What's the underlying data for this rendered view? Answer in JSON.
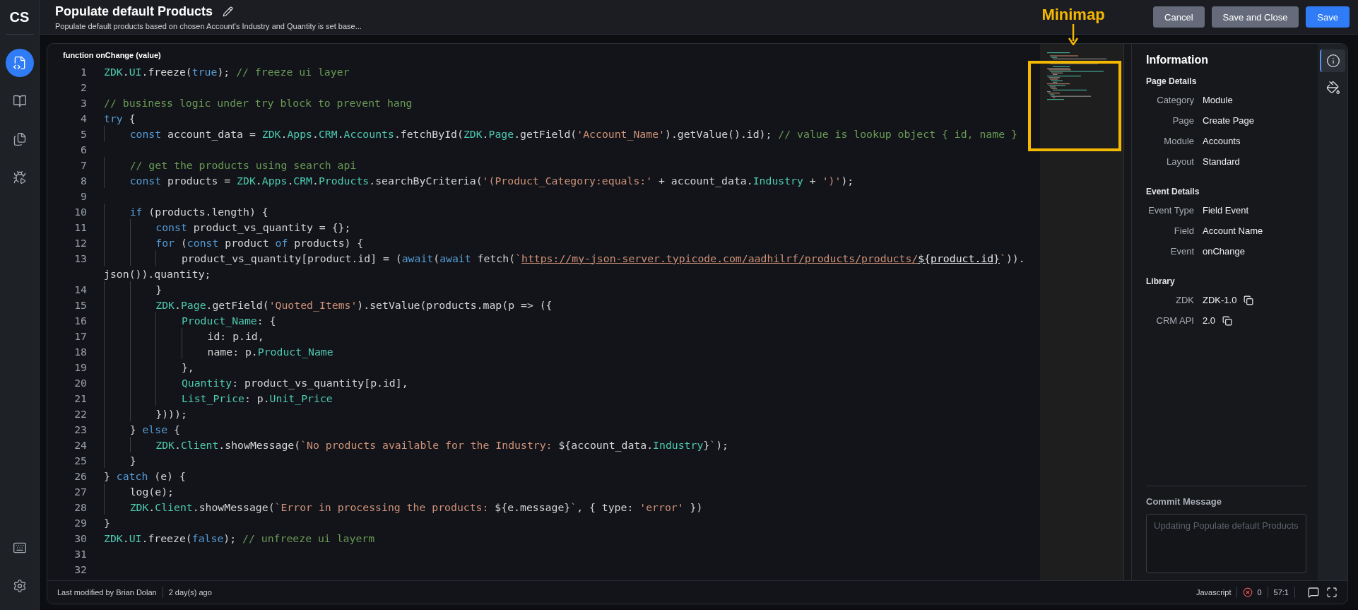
{
  "sidebar": {
    "logo": "CS",
    "items": [
      {
        "kind": "code",
        "selected": true
      },
      {
        "kind": "book",
        "selected": false
      },
      {
        "kind": "docs",
        "selected": false
      },
      {
        "kind": "run",
        "selected": false
      }
    ]
  },
  "header": {
    "title": "Populate default Products",
    "subtitle": "Populate default products based on chosen Account's Industry and Quantity is set base...",
    "buttons": [
      {
        "label": "Cancel",
        "kind": "secondary"
      },
      {
        "label": "Save and Close",
        "kind": "secondary"
      },
      {
        "label": "Save",
        "kind": "primary"
      }
    ]
  },
  "annotation": {
    "label": "Minimap"
  },
  "editor": {
    "signature": "function onChange (value)",
    "lines": [
      {
        "number": "1",
        "tokens": [
          {
            "kind": "obj",
            "text": "ZDK"
          },
          {
            "kind": "txt",
            "text": "."
          },
          {
            "kind": "obj",
            "text": "UI"
          },
          {
            "kind": "txt",
            "text": ".freeze("
          },
          {
            "kind": "kw",
            "text": "true"
          },
          {
            "kind": "txt",
            "text": "); "
          },
          {
            "kind": "cm",
            "text": "// freeze ui layer"
          }
        ]
      },
      {
        "number": "2"
      },
      {
        "number": "3",
        "tokens": [
          {
            "kind": "cm",
            "text": "// business logic under try block to prevent hang"
          }
        ]
      },
      {
        "number": "4",
        "tokens": [
          {
            "kind": "kw",
            "text": "try"
          },
          {
            "kind": "txt",
            "text": " {"
          }
        ]
      },
      {
        "number": "5",
        "tokens": [
          {
            "kind": "kw",
            "text": "    const"
          },
          {
            "kind": "txt",
            "text": " account_data = "
          },
          {
            "kind": "obj",
            "text": "ZDK"
          },
          {
            "kind": "txt",
            "text": "."
          },
          {
            "kind": "obj",
            "text": "Apps"
          },
          {
            "kind": "txt",
            "text": "."
          },
          {
            "kind": "obj",
            "text": "CRM"
          },
          {
            "kind": "txt",
            "text": "."
          },
          {
            "kind": "obj",
            "text": "Accounts"
          },
          {
            "kind": "txt",
            "text": ".fetchById("
          },
          {
            "kind": "obj",
            "text": "ZDK"
          },
          {
            "kind": "txt",
            "text": "."
          },
          {
            "kind": "obj",
            "text": "Page"
          },
          {
            "kind": "txt",
            "text": ".getField("
          },
          {
            "kind": "str",
            "text": "'Account_Name'"
          },
          {
            "kind": "txt",
            "text": ").getValue().id); "
          },
          {
            "kind": "cm",
            "text": "// value is lookup object { id, name }"
          }
        ]
      },
      {
        "number": "6"
      },
      {
        "number": "7",
        "tokens": [
          {
            "kind": "cm",
            "text": "    // get the products using search api"
          }
        ]
      },
      {
        "number": "8",
        "tokens": [
          {
            "kind": "kw",
            "text": "    const"
          },
          {
            "kind": "txt",
            "text": " products = "
          },
          {
            "kind": "obj",
            "text": "ZDK"
          },
          {
            "kind": "txt",
            "text": "."
          },
          {
            "kind": "obj",
            "text": "Apps"
          },
          {
            "kind": "txt",
            "text": "."
          },
          {
            "kind": "obj",
            "text": "CRM"
          },
          {
            "kind": "txt",
            "text": "."
          },
          {
            "kind": "obj",
            "text": "Products"
          },
          {
            "kind": "txt",
            "text": ".searchByCriteria("
          },
          {
            "kind": "str",
            "text": "'(Product_Category:equals:'"
          },
          {
            "kind": "txt",
            "text": " + account_data."
          },
          {
            "kind": "obj",
            "text": "Industry"
          },
          {
            "kind": "txt",
            "text": " + "
          },
          {
            "kind": "str",
            "text": "')'"
          },
          {
            "kind": "txt",
            "text": ");"
          }
        ]
      },
      {
        "number": "9"
      },
      {
        "number": "10",
        "tokens": [
          {
            "kind": "kw",
            "text": "    if"
          },
          {
            "kind": "txt",
            "text": " (products.length) {"
          }
        ]
      },
      {
        "number": "11",
        "tokens": [
          {
            "kind": "kw",
            "text": "        const"
          },
          {
            "kind": "txt",
            "text": " product_vs_quantity = {};"
          }
        ]
      },
      {
        "number": "12",
        "tokens": [
          {
            "kind": "kw",
            "text": "        for"
          },
          {
            "kind": "txt",
            "text": " ("
          },
          {
            "kind": "kw",
            "text": "const"
          },
          {
            "kind": "txt",
            "text": " product "
          },
          {
            "kind": "kw",
            "text": "of"
          },
          {
            "kind": "txt",
            "text": " products) {"
          }
        ]
      },
      {
        "number": "13",
        "tokens": [
          {
            "kind": "txt",
            "text": "            product_vs_quantity[product.id] = ("
          },
          {
            "kind": "kw",
            "text": "await"
          },
          {
            "kind": "txt",
            "text": "("
          },
          {
            "kind": "kw",
            "text": "await"
          },
          {
            "kind": "txt",
            "text": " fetch("
          },
          {
            "kind": "str",
            "text": "`"
          },
          {
            "kind": "url",
            "text": "https://my-json-server.typicode.com/aadhilrf/products/products/"
          },
          {
            "kind": "tpl",
            "text": "${product.id}"
          },
          {
            "kind": "str",
            "text": "`"
          },
          {
            "kind": "txt",
            "text": "))."
          }
        ],
        "continuation": [
          {
            "kind": "txt",
            "text": "json()).quantity;"
          }
        ]
      },
      {
        "number": "14",
        "tokens": [
          {
            "kind": "txt",
            "text": "        }"
          }
        ]
      },
      {
        "number": "15",
        "tokens": [
          {
            "kind": "obj",
            "text": "        ZDK"
          },
          {
            "kind": "txt",
            "text": "."
          },
          {
            "kind": "obj",
            "text": "Page"
          },
          {
            "kind": "txt",
            "text": ".getField("
          },
          {
            "kind": "str",
            "text": "'Quoted_Items'"
          },
          {
            "kind": "txt",
            "text": ").setValue(products.map(p => ({"
          }
        ]
      },
      {
        "number": "16",
        "tokens": [
          {
            "kind": "obj",
            "text": "            Product_Name"
          },
          {
            "kind": "txt",
            "text": ": {"
          }
        ]
      },
      {
        "number": "17",
        "tokens": [
          {
            "kind": "txt",
            "text": "                id: p.id,"
          }
        ]
      },
      {
        "number": "18",
        "tokens": [
          {
            "kind": "txt",
            "text": "                name: p."
          },
          {
            "kind": "obj",
            "text": "Product_Name"
          }
        ]
      },
      {
        "number": "19",
        "tokens": [
          {
            "kind": "txt",
            "text": "            },"
          }
        ]
      },
      {
        "number": "20",
        "tokens": [
          {
            "kind": "obj",
            "text": "            Quantity"
          },
          {
            "kind": "txt",
            "text": ": product_vs_quantity[p.id],"
          }
        ]
      },
      {
        "number": "21",
        "tokens": [
          {
            "kind": "obj",
            "text": "            List_Price"
          },
          {
            "kind": "txt",
            "text": ": p."
          },
          {
            "kind": "obj",
            "text": "Unit_Price"
          }
        ]
      },
      {
        "number": "22",
        "tokens": [
          {
            "kind": "txt",
            "text": "        })));"
          }
        ]
      },
      {
        "number": "23",
        "tokens": [
          {
            "kind": "txt",
            "text": "    } "
          },
          {
            "kind": "kw",
            "text": "else"
          },
          {
            "kind": "txt",
            "text": " {"
          }
        ]
      },
      {
        "number": "24",
        "tokens": [
          {
            "kind": "obj",
            "text": "        ZDK"
          },
          {
            "kind": "txt",
            "text": "."
          },
          {
            "kind": "obj",
            "text": "Client"
          },
          {
            "kind": "txt",
            "text": ".showMessage("
          },
          {
            "kind": "str",
            "text": "`No products available for the Industry: "
          },
          {
            "kind": "txt",
            "text": "${account_data."
          },
          {
            "kind": "obj",
            "text": "Industry"
          },
          {
            "kind": "txt",
            "text": "}"
          },
          {
            "kind": "str",
            "text": "`"
          },
          {
            "kind": "txt",
            "text": ");"
          }
        ]
      },
      {
        "number": "25",
        "tokens": [
          {
            "kind": "txt",
            "text": "    }"
          }
        ]
      },
      {
        "number": "26",
        "tokens": [
          {
            "kind": "txt",
            "text": "} "
          },
          {
            "kind": "kw",
            "text": "catch"
          },
          {
            "kind": "txt",
            "text": " (e) {"
          }
        ]
      },
      {
        "number": "27",
        "tokens": [
          {
            "kind": "txt",
            "text": "    log(e);"
          }
        ]
      },
      {
        "number": "28",
        "tokens": [
          {
            "kind": "obj",
            "text": "    ZDK"
          },
          {
            "kind": "txt",
            "text": "."
          },
          {
            "kind": "obj",
            "text": "Client"
          },
          {
            "kind": "txt",
            "text": ".showMessage("
          },
          {
            "kind": "str",
            "text": "`Error in processing the products: "
          },
          {
            "kind": "txt",
            "text": "${e.message}"
          },
          {
            "kind": "str",
            "text": "`"
          },
          {
            "kind": "txt",
            "text": ", { type: "
          },
          {
            "kind": "str",
            "text": "'error'"
          },
          {
            "kind": "txt",
            "text": " })"
          }
        ]
      },
      {
        "number": "29",
        "tokens": [
          {
            "kind": "txt",
            "text": "}"
          }
        ]
      },
      {
        "number": "30",
        "tokens": [
          {
            "kind": "obj",
            "text": "ZDK"
          },
          {
            "kind": "txt",
            "text": "."
          },
          {
            "kind": "obj",
            "text": "UI"
          },
          {
            "kind": "txt",
            "text": ".freeze("
          },
          {
            "kind": "kw",
            "text": "false"
          },
          {
            "kind": "txt",
            "text": "); "
          },
          {
            "kind": "cm",
            "text": "// unfreeze ui layerm"
          }
        ]
      },
      {
        "number": "31"
      },
      {
        "number": "32"
      }
    ]
  },
  "info": {
    "title": "Information",
    "sections": [
      {
        "heading": "Page Details",
        "rows": [
          {
            "label": "Category",
            "value": "Module",
            "copy": false
          },
          {
            "label": "Page",
            "value": "Create Page",
            "copy": false
          },
          {
            "label": "Module",
            "value": "Accounts",
            "copy": false
          },
          {
            "label": "Layout",
            "value": "Standard",
            "copy": false
          }
        ]
      },
      {
        "heading": "Event Details",
        "rows": [
          {
            "label": "Event Type",
            "value": "Field Event",
            "copy": false
          },
          {
            "label": "Field",
            "value": "Account Name",
            "copy": false
          },
          {
            "label": "Event",
            "value": "onChange",
            "copy": false
          }
        ]
      },
      {
        "heading": "Library",
        "rows": [
          {
            "label": "ZDK",
            "value": "ZDK-1.0",
            "copy": true
          },
          {
            "label": "CRM API",
            "value": "2.0",
            "copy": true
          }
        ]
      }
    ],
    "commit": {
      "label": "Commit Message",
      "placeholder": "Updating Populate default Products"
    }
  },
  "side_tabs": [
    {
      "kind": "info",
      "selected": true
    },
    {
      "kind": "bucket",
      "selected": false
    }
  ],
  "status_bar": {
    "modified": "Last modified by Brian Dolan",
    "age": "2 day(s) ago",
    "language": "Javascript",
    "errors": "0",
    "position": "57:1"
  }
}
